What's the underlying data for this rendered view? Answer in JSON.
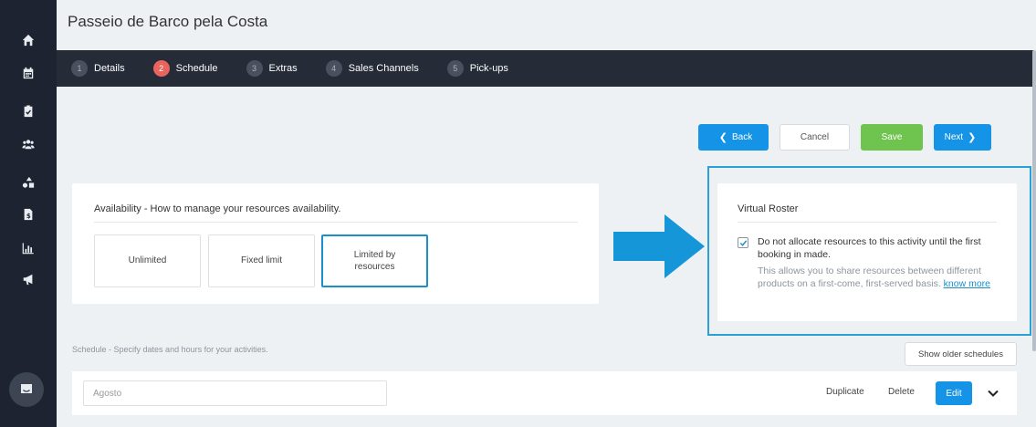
{
  "sidebar": {
    "icons": [
      "home-icon",
      "calendar-icon",
      "clipboard-icon",
      "users-icon",
      "resources-icon",
      "invoice-icon",
      "chart-icon",
      "megaphone-icon"
    ],
    "chat_icon": "chat-icon"
  },
  "page": {
    "title": "Passeio de Barco pela Costa"
  },
  "stepper": {
    "steps": [
      {
        "num": "1",
        "label": "Details"
      },
      {
        "num": "2",
        "label": "Schedule"
      },
      {
        "num": "3",
        "label": "Extras"
      },
      {
        "num": "4",
        "label": "Sales Channels"
      },
      {
        "num": "5",
        "label": "Pick-ups"
      }
    ],
    "active": 2
  },
  "actions": {
    "back": "Back",
    "cancel": "Cancel",
    "save": "Save",
    "next": "Next"
  },
  "availability": {
    "title": "Availability - How to manage your resources availability.",
    "options": [
      "Unlimited",
      "Fixed limit",
      "Limited by resources"
    ],
    "selected": "Limited by resources"
  },
  "roster": {
    "title": "Virtual Roster",
    "checked": true,
    "main_text": "Do not allocate resources to this activity until the first booking in made.",
    "sub_text": "This allows you to share resources between different products on a first-come, first-served basis.",
    "link_text": "know more"
  },
  "schedule": {
    "label": "Schedule - Specify dates and hours for your activities.",
    "older_button": "Show older schedules",
    "row": {
      "placeholder": "Agosto",
      "duplicate": "Duplicate",
      "delete": "Delete",
      "edit": "Edit"
    }
  },
  "colors": {
    "sidebar": "#1d2330",
    "stepper": "#262b38",
    "primary": "#1593e6",
    "success": "#6fc34f",
    "active_step": "#e9645c",
    "highlight": "#2aa0d6"
  }
}
